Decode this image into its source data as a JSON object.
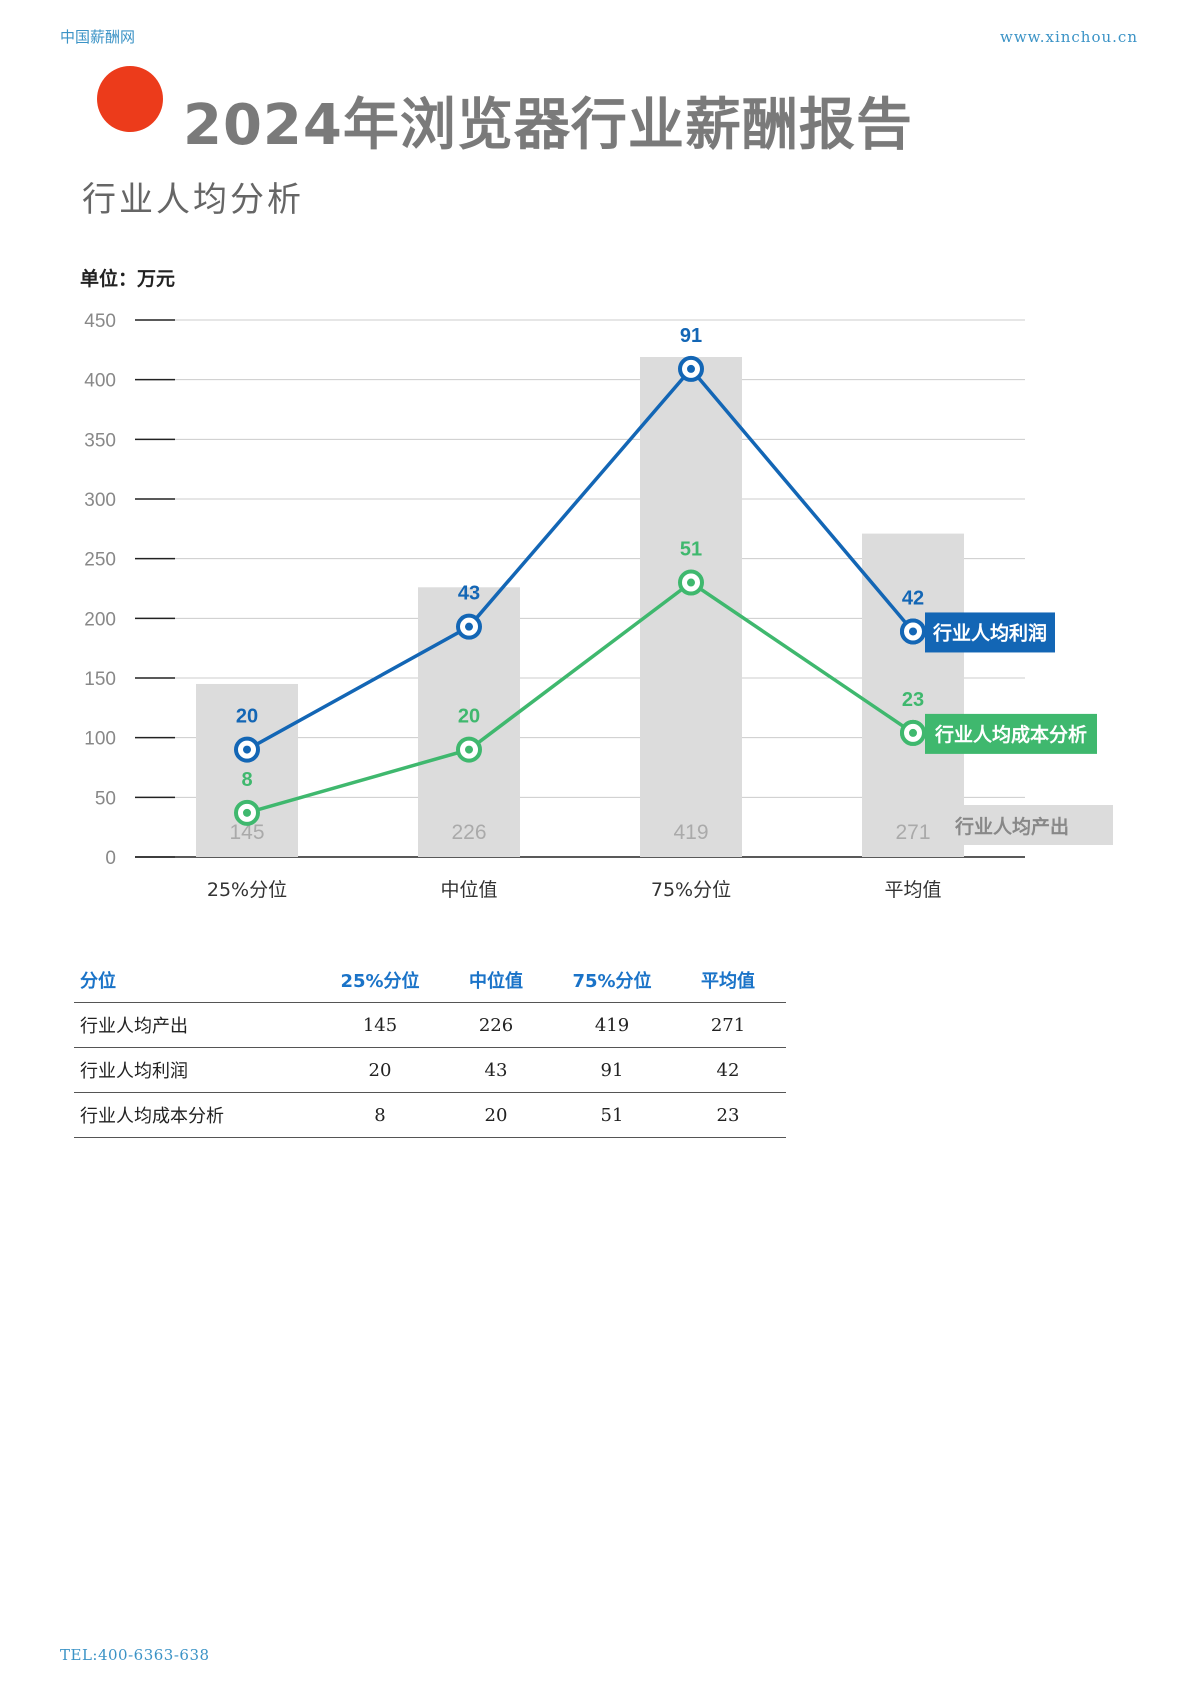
{
  "header": {
    "left": "中国薪酬网",
    "right": "www.xinchou.cn"
  },
  "title": "2024年浏览器行业薪酬报告",
  "subtitle": "行业人均分析",
  "unit_label": "单位：万元",
  "footer": "TEL:400-6363-638",
  "chart_data": {
    "type": "bar",
    "categories": [
      "25%分位",
      "中位值",
      "75%分位",
      "平均值"
    ],
    "ylim": [
      0,
      450
    ],
    "yticks": [
      0,
      50,
      100,
      150,
      200,
      250,
      300,
      350,
      400,
      450
    ],
    "grid": true,
    "series": [
      {
        "name": "行业人均产出",
        "kind": "bar",
        "color": "#dcdcdc",
        "label_color": "#aaaaaa",
        "values": [
          145,
          226,
          419,
          271
        ],
        "plot_values": [
          145,
          226,
          419,
          271
        ]
      },
      {
        "name": "行业人均利润",
        "kind": "line",
        "color": "#1366b5",
        "values": [
          20,
          43,
          91,
          42
        ],
        "plot_values": [
          90,
          193,
          409,
          189
        ]
      },
      {
        "name": "行业人均成本分析",
        "kind": "line",
        "color": "#3fb86e",
        "values": [
          8,
          20,
          51,
          23
        ],
        "plot_values": [
          37,
          90,
          230,
          104
        ]
      }
    ]
  },
  "table": {
    "headers": [
      "分位",
      "25%分位",
      "中位值",
      "75%分位",
      "平均值"
    ],
    "rows": [
      [
        "行业人均产出",
        "145",
        "226",
        "419",
        "271"
      ],
      [
        "行业人均利润",
        "20",
        "43",
        "91",
        "42"
      ],
      [
        "行业人均成本分析",
        "8",
        "20",
        "51",
        "23"
      ]
    ]
  }
}
